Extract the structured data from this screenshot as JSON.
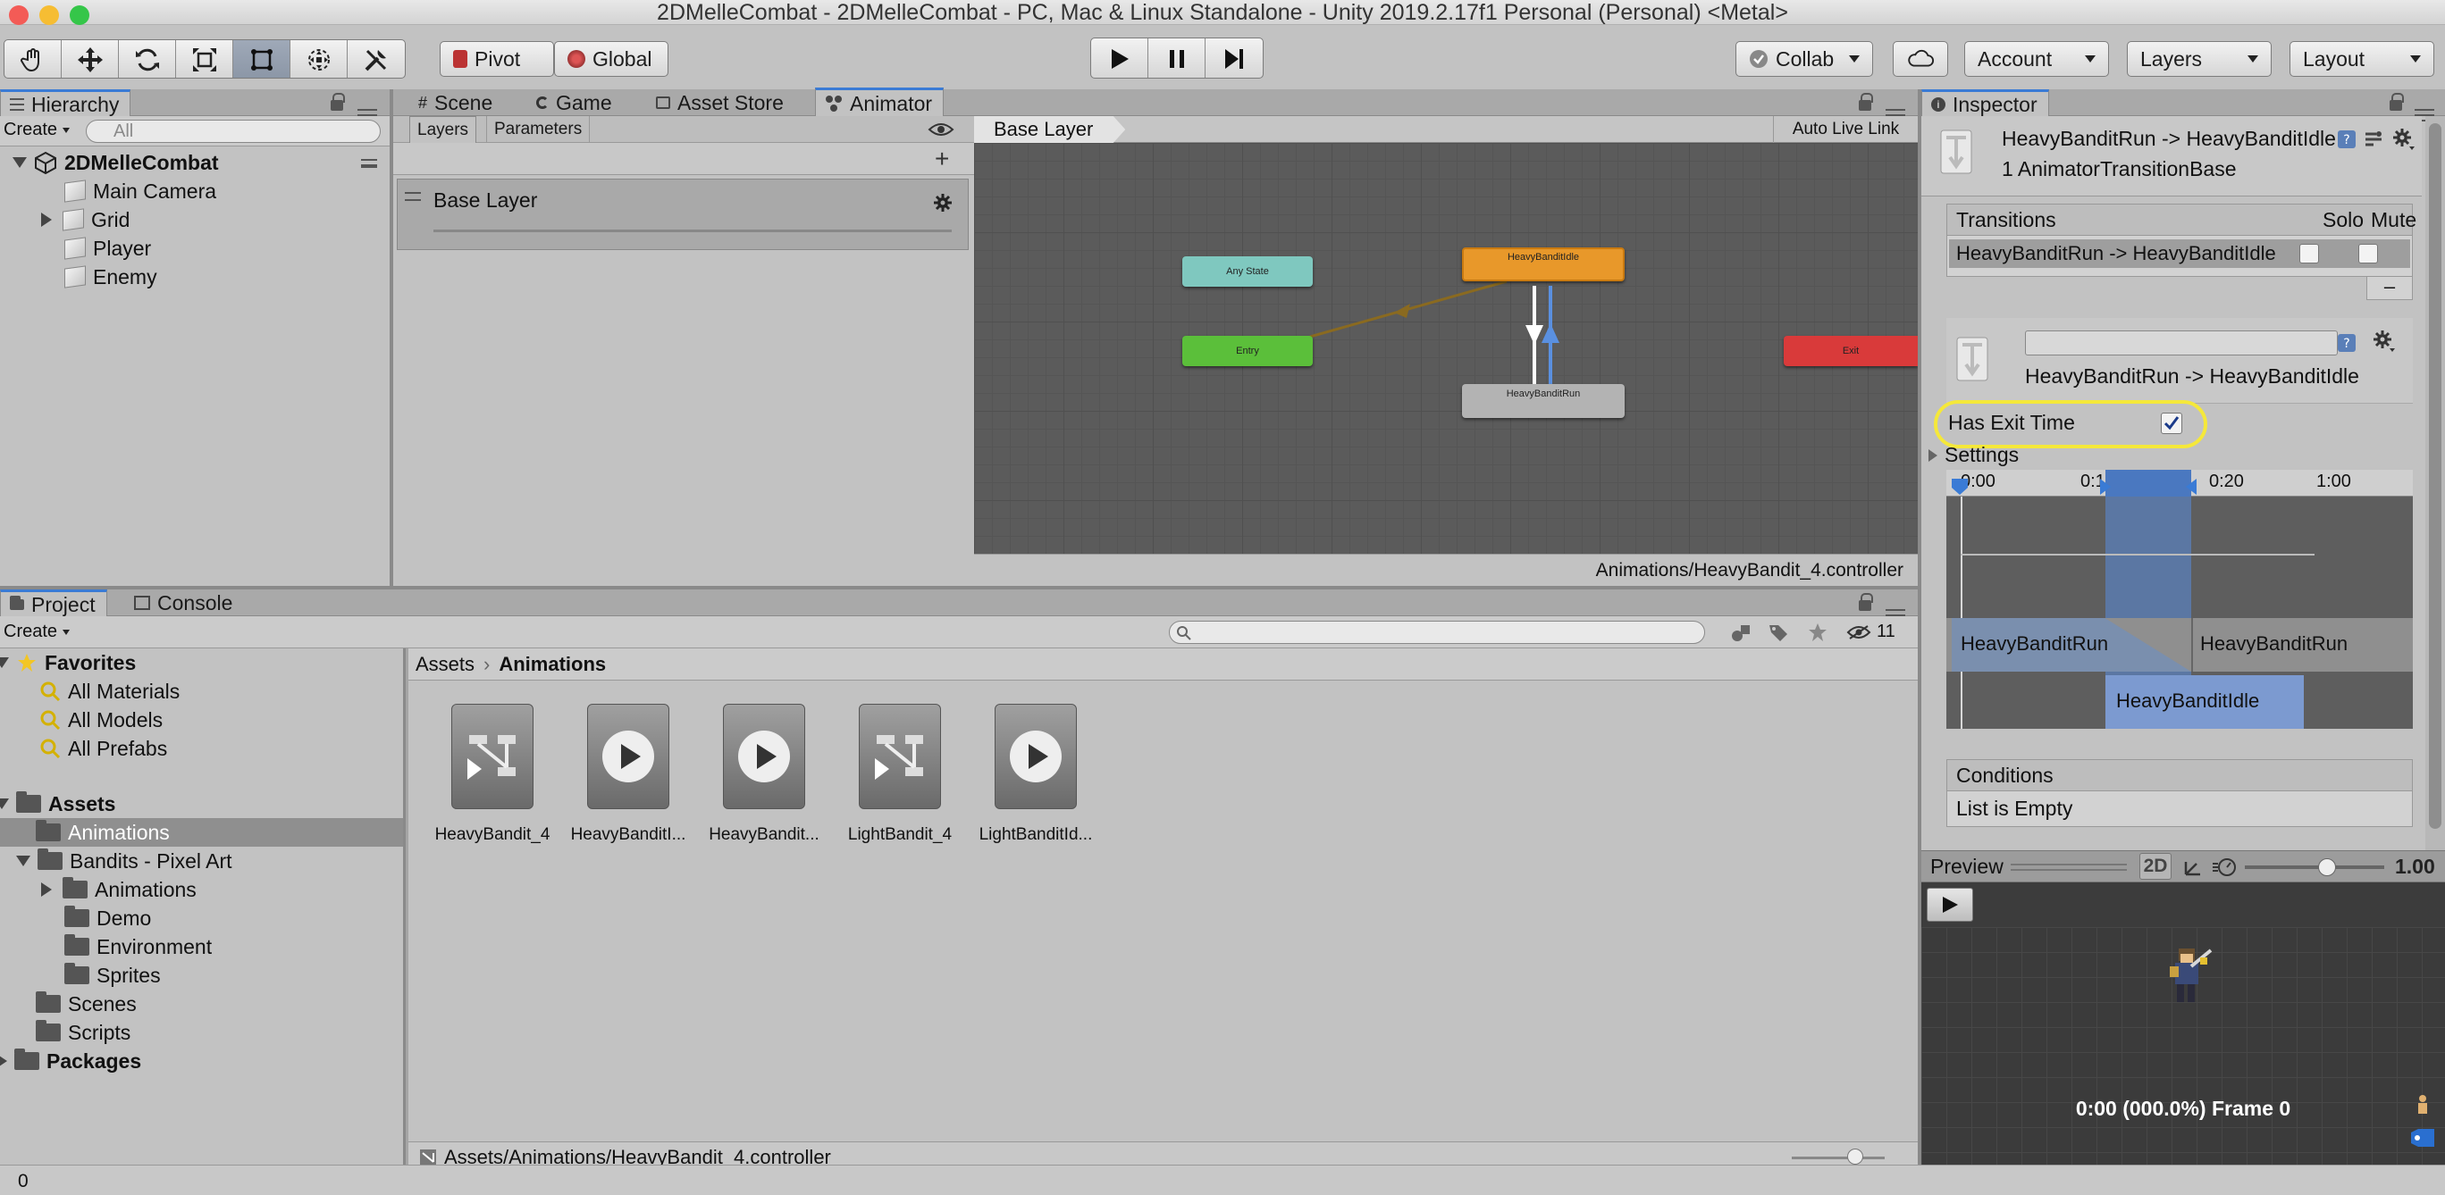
{
  "window": {
    "title": "2DMelleCombat - 2DMelleCombat - PC, Mac & Linux Standalone - Unity 2019.2.17f1 Personal (Personal) <Metal>"
  },
  "toolbar": {
    "tools": [
      "hand-tool",
      "move-tool",
      "rotate-tool",
      "scale-tool",
      "rect-tool",
      "transform-tool",
      "custom-tool"
    ],
    "pivot_label": "Pivot",
    "global_label": "Global",
    "collab_label": "Collab",
    "account_label": "Account",
    "layers_label": "Layers",
    "layout_label": "Layout"
  },
  "hierarchy": {
    "tab": "Hierarchy",
    "create": "Create",
    "search_placeholder": "All",
    "scene": "2DMelleCombat",
    "items": [
      "Main Camera",
      "Grid",
      "Player",
      "Enemy"
    ]
  },
  "center_tabs": {
    "scene": "Scene",
    "game": "Game",
    "asset_store": "Asset Store",
    "animator": "Animator"
  },
  "animator": {
    "layers_tab": "Layers",
    "parameters_tab": "Parameters",
    "layer_name": "Base Layer",
    "breadcrumb": "Base Layer",
    "auto_live_link": "Auto Live Link",
    "footer_path": "Animations/HeavyBandit_4.controller",
    "nodes": {
      "any_state": "Any State",
      "entry": "Entry",
      "idle": "HeavyBanditIdle",
      "run": "HeavyBanditRun",
      "exit": "Exit"
    }
  },
  "project": {
    "tab": "Project",
    "console_tab": "Console",
    "create": "Create",
    "hidden_count": "11",
    "favorites": {
      "label": "Favorites",
      "items": [
        "All Materials",
        "All Models",
        "All Prefabs"
      ]
    },
    "assets_label": "Assets",
    "assets_tree": {
      "animations": "Animations",
      "bandits": "Bandits - Pixel Art",
      "bandits_children": [
        "Animations",
        "Demo",
        "Environment",
        "Sprites"
      ],
      "scenes": "Scenes",
      "scripts": "Scripts"
    },
    "packages_label": "Packages",
    "breadcrumb_root": "Assets",
    "breadcrumb_current": "Animations",
    "files": [
      {
        "name": "HeavyBandit_4",
        "kind": "controller"
      },
      {
        "name": "HeavyBanditI...",
        "kind": "clip"
      },
      {
        "name": "HeavyBandit...",
        "kind": "clip"
      },
      {
        "name": "LightBandit_4",
        "kind": "controller"
      },
      {
        "name": "LightBanditId...",
        "kind": "clip"
      }
    ],
    "footer_path": "Assets/Animations/HeavyBandit_4.controller"
  },
  "inspector": {
    "tab": "Inspector",
    "title": "HeavyBanditRun -> HeavyBanditIdle",
    "subtitle": "1 AnimatorTransitionBase",
    "transitions_header": "Transitions",
    "solo": "Solo",
    "mute": "Mute",
    "transition_row": "HeavyBanditRun -> HeavyBanditIdle",
    "detail_name": "HeavyBanditRun -> HeavyBanditIdle",
    "has_exit_time_label": "Has Exit Time",
    "has_exit_time": true,
    "settings_label": "Settings",
    "timeline_ticks": [
      "0:00",
      "0:10",
      "0:20",
      "1:00"
    ],
    "track_from": "HeavyBanditRun",
    "track_from_2": "HeavyBanditRun",
    "track_to": "HeavyBanditIdle",
    "conditions_header": "Conditions",
    "conditions_empty": "List is Empty"
  },
  "preview": {
    "label": "Preview",
    "mode_2d": "2D",
    "speed": "1.00",
    "frame_info": "0:00 (000.0%) Frame 0"
  },
  "status_bar": {
    "text": "0"
  },
  "colors": {
    "accent": "#3a7bd5",
    "any_state": "#7fc8bf",
    "entry": "#5bbf3a",
    "idle_node": "#e8982a",
    "exit": "#d93a3a",
    "highlight": "#f5e83a"
  }
}
